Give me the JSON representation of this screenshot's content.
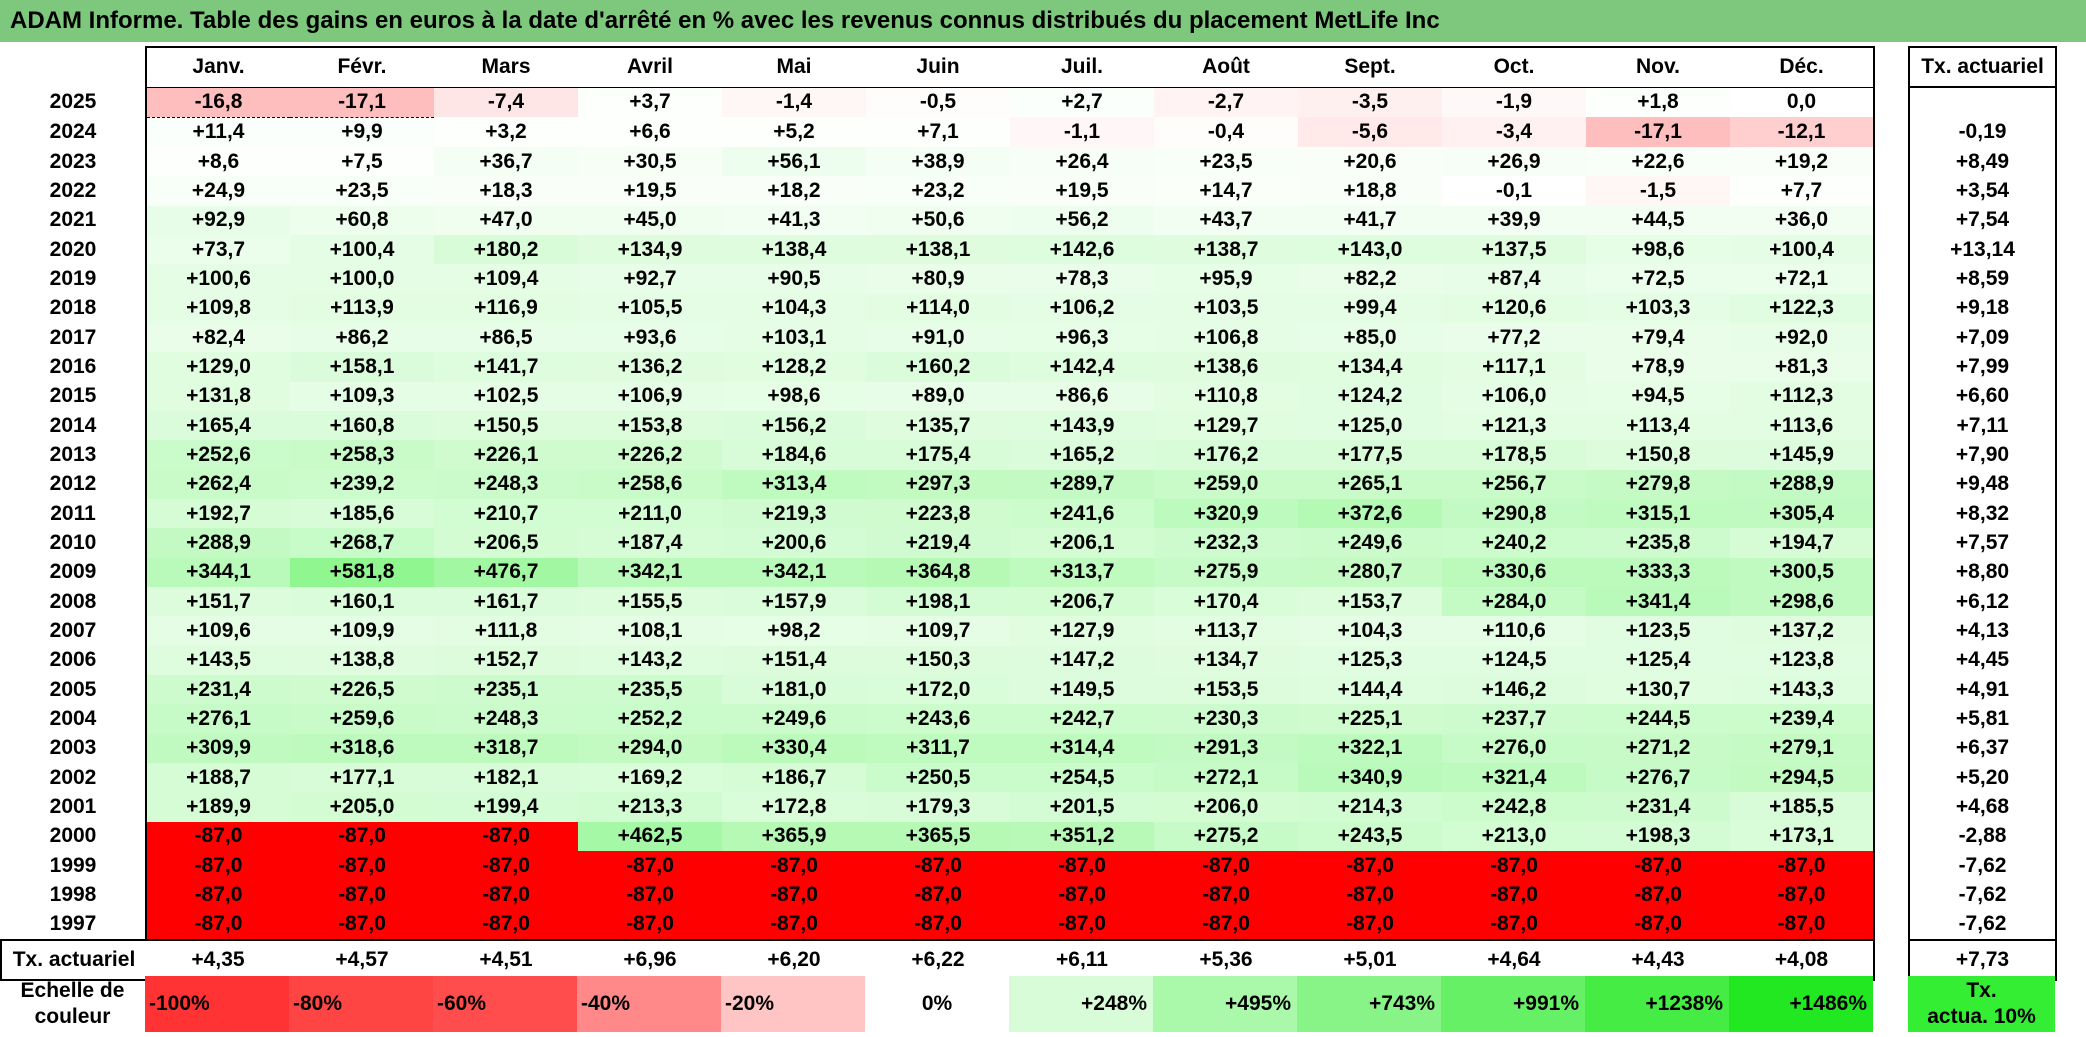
{
  "title": "ADAM Informe. Table des gains en euros à la date d'arrêté en % avec les revenus connus distribués du placement MetLife Inc",
  "header": {
    "months": [
      "Janv.",
      "Févr.",
      "Mars",
      "Avril",
      "Mai",
      "Juin",
      "Juil.",
      "Août",
      "Sept.",
      "Oct.",
      "Nov.",
      "Déc."
    ],
    "tx_label": "Tx. actuariel"
  },
  "rows": [
    {
      "year": "2025",
      "values": [
        "-16,8",
        "-17,1",
        "-7,4",
        "+3,7",
        "-1,4",
        "-0,5",
        "+2,7",
        "-2,7",
        "-3,5",
        "-1,9",
        "+1,8",
        "0,0"
      ],
      "colors": [
        "#ffbebe",
        "#ffbebe",
        "#ffe6e6",
        "#fdfffd",
        "#fff6f6",
        "#fffcfc",
        "#fbfffb",
        "#fff3f3",
        "#fff0f0",
        "#fff8f8",
        "#fcfffc",
        "#ffffff"
      ],
      "tx": ""
    },
    {
      "year": "2024",
      "values": [
        "+11,4",
        "+9,9",
        "+3,2",
        "+6,6",
        "+5,2",
        "+7,1",
        "-1,1",
        "-0,4",
        "-5,6",
        "-3,4",
        "-17,1",
        "-12,1"
      ],
      "colors": [
        "#fbfffb",
        "#fbfffb",
        "#fdfffd",
        "#fcfffc",
        "#fcfffc",
        "#fcfffc",
        "#fff7f7",
        "#fffcfc",
        "#ffe9e9",
        "#fff1f1",
        "#ffbebe",
        "#ffcfcf"
      ],
      "tx": "-0,19"
    },
    {
      "year": "2023",
      "values": [
        "+8,6",
        "+7,5",
        "+36,7",
        "+30,5",
        "+56,1",
        "+38,9",
        "+26,4",
        "+23,5",
        "+20,6",
        "+26,9",
        "+22,6",
        "+19,2"
      ],
      "colors": [
        "#fcfffc",
        "#fcfffc",
        "#f5fef5",
        "#f6fef6",
        "#eefeee",
        "#f4fef4",
        "#f7fef7",
        "#f8fef8",
        "#f9fef9",
        "#f7fef7",
        "#f8fef8",
        "#f9fef9"
      ],
      "tx": "+8,49"
    },
    {
      "year": "2022",
      "values": [
        "+24,9",
        "+23,5",
        "+18,3",
        "+19,5",
        "+18,2",
        "+23,2",
        "+19,5",
        "+14,7",
        "+18,8",
        "-0,1",
        "-1,5",
        "+7,7"
      ],
      "colors": [
        "#f8fef8",
        "#f8fef8",
        "#f9fef9",
        "#f9fef9",
        "#f9fef9",
        "#f8fef8",
        "#f9fef9",
        "#fafffa",
        "#f9fef9",
        "#ffffff",
        "#fff6f6",
        "#fcfffc"
      ],
      "tx": "+3,54"
    },
    {
      "year": "2021",
      "values": [
        "+92,9",
        "+60,8",
        "+47,0",
        "+45,0",
        "+41,3",
        "+50,6",
        "+56,2",
        "+43,7",
        "+41,7",
        "+39,9",
        "+44,5",
        "+36,0"
      ],
      "colors": [
        "#e7fde7",
        "#edfeed",
        "#f0fef0",
        "#f0fef0",
        "#f1fef1",
        "#effeef",
        "#eefeee",
        "#f1fef1",
        "#f1fef1",
        "#f2fef2",
        "#f1fef1",
        "#f3fef3"
      ],
      "tx": "+7,54"
    },
    {
      "year": "2020",
      "values": [
        "+73,7",
        "+100,4",
        "+180,2",
        "+134,9",
        "+138,4",
        "+138,1",
        "+142,6",
        "+138,7",
        "+143,0",
        "+137,5",
        "+98,6",
        "+100,4"
      ],
      "colors": [
        "#ebfdeb",
        "#e5fde5",
        "#d8fcd8",
        "#dffcdf",
        "#dffcdf",
        "#dffcdf",
        "#defcde",
        "#dffcdf",
        "#defcde",
        "#dffcdf",
        "#e6fde6",
        "#e5fde5"
      ],
      "tx": "+13,14"
    },
    {
      "year": "2019",
      "values": [
        "+100,6",
        "+100,0",
        "+109,4",
        "+92,7",
        "+90,5",
        "+80,9",
        "+78,3",
        "+95,9",
        "+82,2",
        "+87,4",
        "+72,5",
        "+72,1"
      ],
      "colors": [
        "#e5fde5",
        "#e5fde5",
        "#e4fde4",
        "#e7fde7",
        "#e7fde7",
        "#e9fde9",
        "#eafdea",
        "#e6fde6",
        "#e9fde9",
        "#e8fde8",
        "#ebfdeb",
        "#ebfdeb"
      ],
      "tx": "+8,59"
    },
    {
      "year": "2018",
      "values": [
        "+109,8",
        "+113,9",
        "+116,9",
        "+105,5",
        "+104,3",
        "+114,0",
        "+106,2",
        "+103,5",
        "+99,4",
        "+120,6",
        "+103,3",
        "+122,3"
      ],
      "colors": [
        "#e4fde4",
        "#e3fde3",
        "#e2fde2",
        "#e4fde4",
        "#e4fde4",
        "#e3fde3",
        "#e4fde4",
        "#e5fde5",
        "#e5fde5",
        "#e2fde2",
        "#e5fde5",
        "#e1fde1"
      ],
      "tx": "+9,18"
    },
    {
      "year": "2017",
      "values": [
        "+82,4",
        "+86,2",
        "+86,5",
        "+93,6",
        "+103,1",
        "+91,0",
        "+96,3",
        "+106,8",
        "+85,0",
        "+77,2",
        "+79,4",
        "+92,0"
      ],
      "colors": [
        "#e9fde9",
        "#e8fde8",
        "#e8fde8",
        "#e7fde7",
        "#e5fde5",
        "#e7fde7",
        "#e6fde6",
        "#e4fde4",
        "#e8fde8",
        "#eafdea",
        "#e9fde9",
        "#e7fde7"
      ],
      "tx": "+7,09"
    },
    {
      "year": "2016",
      "values": [
        "+129,0",
        "+158,1",
        "+141,7",
        "+136,2",
        "+128,2",
        "+160,2",
        "+142,4",
        "+138,6",
        "+134,4",
        "+117,1",
        "+78,9",
        "+81,3"
      ],
      "colors": [
        "#e0fde0",
        "#dbfcdb",
        "#defcde",
        "#dffcdf",
        "#e0fde0",
        "#dbfcdb",
        "#defcde",
        "#dffcdf",
        "#e0fde0",
        "#e2fde2",
        "#e9fde9",
        "#e9fde9"
      ],
      "tx": "+7,99"
    },
    {
      "year": "2015",
      "values": [
        "+131,8",
        "+109,3",
        "+102,5",
        "+106,9",
        "+98,6",
        "+89,0",
        "+86,6",
        "+110,8",
        "+124,2",
        "+106,0",
        "+94,5",
        "+112,3"
      ],
      "colors": [
        "#e0fde0",
        "#e4fde4",
        "#e5fde5",
        "#e4fde4",
        "#e6fde6",
        "#e7fde7",
        "#e8fde8",
        "#e3fde3",
        "#e1fde1",
        "#e4fde4",
        "#e6fde6",
        "#e3fde3"
      ],
      "tx": "+6,60"
    },
    {
      "year": "2014",
      "values": [
        "+165,4",
        "+160,8",
        "+150,5",
        "+153,8",
        "+156,2",
        "+135,7",
        "+143,9",
        "+129,7",
        "+125,0",
        "+121,3",
        "+113,4",
        "+113,6"
      ],
      "colors": [
        "#dafcda",
        "#dbfcdb",
        "#dcfcdc",
        "#dcfcdc",
        "#dbfcdb",
        "#dffcdf",
        "#defcde",
        "#e0fde0",
        "#e1fde1",
        "#e2fde2",
        "#e3fde3",
        "#e3fde3"
      ],
      "tx": "+7,11"
    },
    {
      "year": "2013",
      "values": [
        "+252,6",
        "+258,3",
        "+226,1",
        "+226,2",
        "+184,6",
        "+175,4",
        "+165,2",
        "+176,2",
        "+177,5",
        "+178,5",
        "+150,8",
        "+145,9"
      ],
      "colors": [
        "#cafbca",
        "#c9fbc9",
        "#cffbcf",
        "#cffbcf",
        "#d7fcd7",
        "#d8fcd8",
        "#dafcda",
        "#d8fcd8",
        "#d8fcd8",
        "#d8fcd8",
        "#dcfcdc",
        "#ddfcdd"
      ],
      "tx": "+7,90"
    },
    {
      "year": "2012",
      "values": [
        "+262,4",
        "+239,2",
        "+248,3",
        "+258,6",
        "+313,4",
        "+297,3",
        "+289,7",
        "+259,0",
        "+265,1",
        "+256,7",
        "+279,8",
        "+288,9"
      ],
      "colors": [
        "#c8fbc8",
        "#ccfbcc",
        "#cbfbcb",
        "#c9fbc9",
        "#bffabf",
        "#c2fac2",
        "#c3fac3",
        "#c9fbc9",
        "#c8fbc8",
        "#c9fbc9",
        "#c5fac5",
        "#c3fac3"
      ],
      "tx": "+9,48"
    },
    {
      "year": "2011",
      "values": [
        "+192,7",
        "+185,6",
        "+210,7",
        "+211,0",
        "+219,3",
        "+223,8",
        "+241,6",
        "+320,9",
        "+372,6",
        "+290,8",
        "+315,1",
        "+305,4"
      ],
      "colors": [
        "#d5fcd5",
        "#d7fcd7",
        "#d2fcd2",
        "#d2fcd2",
        "#d0fbd0",
        "#cffbcf",
        "#ccfbcc",
        "#bdfabd",
        "#b4f9b4",
        "#c3fac3",
        "#bffabf",
        "#c1fac1"
      ],
      "tx": "+8,32"
    },
    {
      "year": "2010",
      "values": [
        "+288,9",
        "+268,7",
        "+206,5",
        "+187,4",
        "+200,6",
        "+219,4",
        "+206,1",
        "+232,3",
        "+249,6",
        "+240,2",
        "+235,8",
        "+194,7"
      ],
      "colors": [
        "#c3fac3",
        "#c7fbc7",
        "#d3fcd3",
        "#d6fcd6",
        "#d4fcd4",
        "#d0fbd0",
        "#d3fcd3",
        "#cefbce",
        "#cbfbcb",
        "#ccfbcc",
        "#cdfbcd",
        "#d5fcd5"
      ],
      "tx": "+7,57"
    },
    {
      "year": "2009",
      "values": [
        "+344,1",
        "+581,8",
        "+476,7",
        "+342,1",
        "+342,1",
        "+364,8",
        "+313,7",
        "+275,9",
        "+280,7",
        "+330,6",
        "+333,3",
        "+300,5"
      ],
      "colors": [
        "#b9f9b9",
        "#90f690",
        "#a2f8a2",
        "#b9f9b9",
        "#b9f9b9",
        "#b5f9b5",
        "#bffabf",
        "#c6fac6",
        "#c5fac5",
        "#bcfabc",
        "#bbfabb",
        "#c1fac1"
      ],
      "tx": "+8,80"
    },
    {
      "year": "2008",
      "values": [
        "+151,7",
        "+160,1",
        "+161,7",
        "+155,5",
        "+157,9",
        "+198,1",
        "+206,7",
        "+170,4",
        "+153,7",
        "+284,0",
        "+341,4",
        "+298,6"
      ],
      "colors": [
        "#dcfcdc",
        "#dbfcdb",
        "#dbfcdb",
        "#dcfcdc",
        "#dbfcdb",
        "#d4fcd4",
        "#d3fcd3",
        "#d9fcd9",
        "#dcfcdc",
        "#c4fac4",
        "#b9f9b9",
        "#c1fac1"
      ],
      "tx": "+6,12"
    },
    {
      "year": "2007",
      "values": [
        "+109,6",
        "+109,9",
        "+111,8",
        "+108,1",
        "+98,2",
        "+109,7",
        "+127,9",
        "+113,7",
        "+104,3",
        "+110,6",
        "+123,5",
        "+137,2"
      ],
      "colors": [
        "#e4fde4",
        "#e4fde4",
        "#e3fde3",
        "#e4fde4",
        "#e6fde6",
        "#e4fde4",
        "#e0fde0",
        "#e3fde3",
        "#e4fde4",
        "#e4fde4",
        "#e1fde1",
        "#dffcdf"
      ],
      "tx": "+4,13"
    },
    {
      "year": "2006",
      "values": [
        "+143,5",
        "+138,8",
        "+152,7",
        "+143,2",
        "+151,4",
        "+150,3",
        "+147,2",
        "+134,7",
        "+125,3",
        "+124,5",
        "+125,4",
        "+123,8"
      ],
      "colors": [
        "#defcde",
        "#dffcdf",
        "#dcfcdc",
        "#defcde",
        "#dcfcdc",
        "#dcfcdc",
        "#ddfcdd",
        "#dffcdf",
        "#e1fde1",
        "#e1fde1",
        "#e1fde1",
        "#e1fde1"
      ],
      "tx": "+4,45"
    },
    {
      "year": "2005",
      "values": [
        "+231,4",
        "+226,5",
        "+235,1",
        "+235,5",
        "+181,0",
        "+172,0",
        "+149,5",
        "+153,5",
        "+144,4",
        "+146,2",
        "+130,7",
        "+143,3"
      ],
      "colors": [
        "#cefbce",
        "#cffbcf",
        "#cdfbcd",
        "#cdfbcd",
        "#d7fcd7",
        "#d9fcd9",
        "#ddfcdd",
        "#dcfcdc",
        "#defcde",
        "#ddfcdd",
        "#e0fde0",
        "#defcde"
      ],
      "tx": "+4,91"
    },
    {
      "year": "2004",
      "values": [
        "+276,1",
        "+259,6",
        "+248,3",
        "+252,2",
        "+249,6",
        "+243,6",
        "+242,7",
        "+230,3",
        "+225,1",
        "+237,7",
        "+244,5",
        "+239,4"
      ],
      "colors": [
        "#c6fac6",
        "#c9fbc9",
        "#cbfbcb",
        "#cafbca",
        "#cbfbcb",
        "#ccfbcc",
        "#ccfbcc",
        "#cefbce",
        "#cffbcf",
        "#cdfbcd",
        "#ccfbcc",
        "#ccfbcc"
      ],
      "tx": "+5,81"
    },
    {
      "year": "2003",
      "values": [
        "+309,9",
        "+318,6",
        "+318,7",
        "+294,0",
        "+330,4",
        "+311,7",
        "+314,4",
        "+291,3",
        "+322,1",
        "+276,0",
        "+271,2",
        "+279,1"
      ],
      "colors": [
        "#c0fac0",
        "#befabe",
        "#befabe",
        "#c2fac2",
        "#bcfabc",
        "#bffabf",
        "#bffabf",
        "#c3fac3",
        "#bdfabd",
        "#c6fac6",
        "#c7fac7",
        "#c5fac5"
      ],
      "tx": "+6,37"
    },
    {
      "year": "2002",
      "values": [
        "+188,7",
        "+177,1",
        "+182,1",
        "+169,2",
        "+186,7",
        "+250,5",
        "+254,5",
        "+272,1",
        "+340,9",
        "+321,4",
        "+276,7",
        "+294,5"
      ],
      "colors": [
        "#d6fcd6",
        "#d8fcd8",
        "#d7fcd7",
        "#d9fcd9",
        "#d6fcd6",
        "#cafbca",
        "#cafbca",
        "#c6fac6",
        "#b9f9b9",
        "#bdfabd",
        "#c6fac6",
        "#c2fac2"
      ],
      "tx": "+5,20"
    },
    {
      "year": "2001",
      "values": [
        "+189,9",
        "+205,0",
        "+199,4",
        "+213,3",
        "+172,8",
        "+179,3",
        "+201,5",
        "+206,0",
        "+214,3",
        "+242,8",
        "+231,4",
        "+185,5"
      ],
      "colors": [
        "#d6fcd6",
        "#d3fcd3",
        "#d4fcd4",
        "#d1fcd1",
        "#d9fcd9",
        "#d8fcd8",
        "#d4fcd4",
        "#d3fcd3",
        "#d1fcd1",
        "#ccfbcc",
        "#cefbce",
        "#d7fcd7"
      ],
      "tx": "+4,68"
    },
    {
      "year": "2000",
      "values": [
        "-87,0",
        "-87,0",
        "-87,0",
        "+462,5",
        "+365,9",
        "+365,5",
        "+351,2",
        "+275,2",
        "+243,5",
        "+213,0",
        "+198,3",
        "+173,1"
      ],
      "colors": [
        "#ff0000",
        "#ff0000",
        "#ff0000",
        "#a5f8a5",
        "#b5f9b5",
        "#b5f9b5",
        "#b8f9b8",
        "#c6fac6",
        "#ccfbcc",
        "#d2fcd2",
        "#d4fcd4",
        "#d9fcd9"
      ],
      "tx": "-2,88"
    },
    {
      "year": "1999",
      "values": [
        "-87,0",
        "-87,0",
        "-87,0",
        "-87,0",
        "-87,0",
        "-87,0",
        "-87,0",
        "-87,0",
        "-87,0",
        "-87,0",
        "-87,0",
        "-87,0"
      ],
      "colors": [
        "#ff0000",
        "#ff0000",
        "#ff0000",
        "#ff0000",
        "#ff0000",
        "#ff0000",
        "#ff0000",
        "#ff0000",
        "#ff0000",
        "#ff0000",
        "#ff0000",
        "#ff0000"
      ],
      "tx": "-7,62"
    },
    {
      "year": "1998",
      "values": [
        "-87,0",
        "-87,0",
        "-87,0",
        "-87,0",
        "-87,0",
        "-87,0",
        "-87,0",
        "-87,0",
        "-87,0",
        "-87,0",
        "-87,0",
        "-87,0"
      ],
      "colors": [
        "#ff0000",
        "#ff0000",
        "#ff0000",
        "#ff0000",
        "#ff0000",
        "#ff0000",
        "#ff0000",
        "#ff0000",
        "#ff0000",
        "#ff0000",
        "#ff0000",
        "#ff0000"
      ],
      "tx": "-7,62"
    },
    {
      "year": "1997",
      "values": [
        "-87,0",
        "-87,0",
        "-87,0",
        "-87,0",
        "-87,0",
        "-87,0",
        "-87,0",
        "-87,0",
        "-87,0",
        "-87,0",
        "-87,0",
        "-87,0"
      ],
      "colors": [
        "#ff0000",
        "#ff0000",
        "#ff0000",
        "#ff0000",
        "#ff0000",
        "#ff0000",
        "#ff0000",
        "#ff0000",
        "#ff0000",
        "#ff0000",
        "#ff0000",
        "#ff0000"
      ],
      "tx": "-7,62"
    }
  ],
  "footer": {
    "label": "Tx. actuariel",
    "values": [
      "+4,35",
      "+4,57",
      "+4,51",
      "+6,96",
      "+6,20",
      "+6,22",
      "+6,11",
      "+5,36",
      "+5,01",
      "+4,64",
      "+4,43",
      "+4,08"
    ],
    "tx": "+7,73"
  },
  "scale": {
    "label_line1": "Echelle de",
    "label_line2": "couleur",
    "items": [
      {
        "text": "-100%",
        "color": "#ff3333",
        "align": "left"
      },
      {
        "text": "-80%",
        "color": "#ff4444",
        "align": "left"
      },
      {
        "text": "-60%",
        "color": "#ff4d4d",
        "align": "left"
      },
      {
        "text": "-40%",
        "color": "#ff8888",
        "align": "left"
      },
      {
        "text": "-20%",
        "color": "#ffc4c4",
        "align": "left"
      },
      {
        "text": "0%",
        "color": "#ffffff",
        "align": "center"
      },
      {
        "text": "+248%",
        "color": "#d8fcd8",
        "align": "right"
      },
      {
        "text": "+495%",
        "color": "#aaf8aa",
        "align": "right"
      },
      {
        "text": "+743%",
        "color": "#88f488",
        "align": "right"
      },
      {
        "text": "+991%",
        "color": "#66f066",
        "align": "right"
      },
      {
        "text": "+1238%",
        "color": "#44ec44",
        "align": "right"
      },
      {
        "text": "+1486%",
        "color": "#22e822",
        "align": "right"
      }
    ],
    "tx_line1": "Tx.",
    "tx_line2": "actua. 10%",
    "tx_color": "#33ee33"
  }
}
